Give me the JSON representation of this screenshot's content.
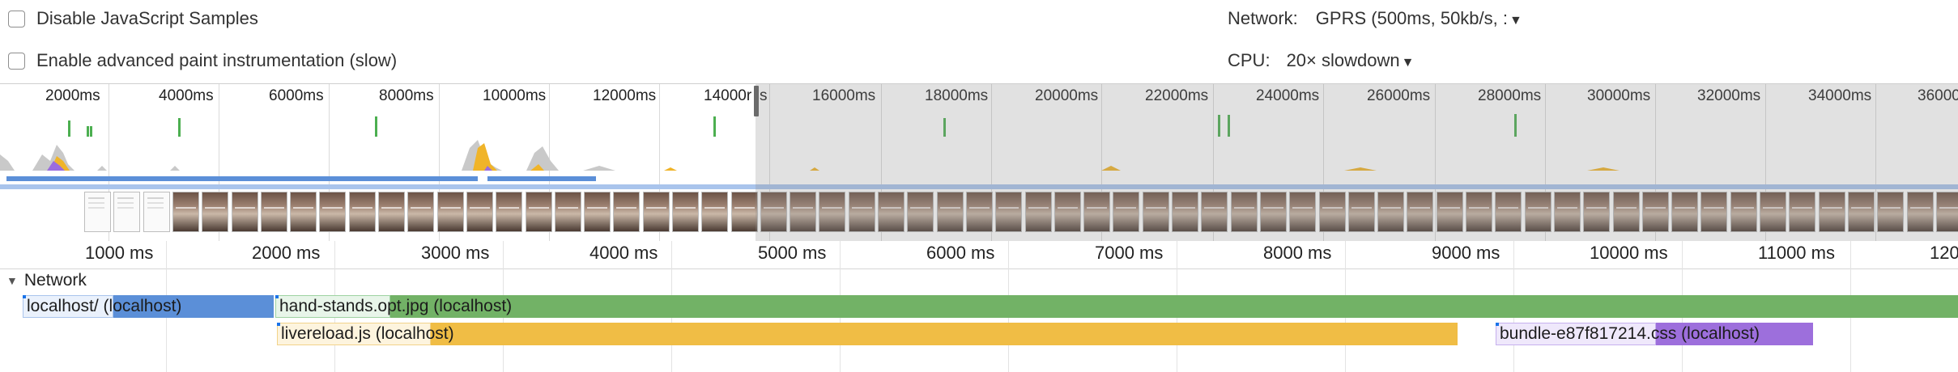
{
  "settings": {
    "disable_js_samples": {
      "label": "Disable JavaScript Samples",
      "checked": false
    },
    "advanced_paint": {
      "label": "Enable advanced paint instrumentation (slow)",
      "checked": false
    },
    "network": {
      "label": "Network:",
      "value": "GPRS (500ms, 50kb/s, :"
    },
    "cpu": {
      "label": "CPU:",
      "value": "20× slowdown"
    }
  },
  "overview": {
    "tick_labels": [
      "2000ms",
      "4000ms",
      "6000ms",
      "8000ms",
      "10000ms",
      "12000ms",
      "14000r",
      "s",
      "16000ms",
      "18000ms",
      "20000ms",
      "22000ms",
      "24000ms",
      "26000ms",
      "28000ms",
      "30000ms",
      "32000ms",
      "34000ms",
      "36000"
    ]
  },
  "ruler": {
    "labels": [
      "1000 ms",
      "2000 ms",
      "3000 ms",
      "4000 ms",
      "5000 ms",
      "6000 ms",
      "7000 ms",
      "8000 ms",
      "9000 ms",
      "10000 ms",
      "11000 ms",
      "120"
    ]
  },
  "network": {
    "section_label": "Network",
    "requests": [
      {
        "name": "localhost/ (localhost)",
        "color": "#4a90e2"
      },
      {
        "name": "hand-stands.opt.jpg (localhost)",
        "color": "#4caf50"
      },
      {
        "name": "livereload.js (localhost)",
        "color": "#f0b429"
      },
      {
        "name": "bundle-e87f817214.css (localhost)",
        "color": "#9b6dde"
      }
    ]
  },
  "colors": {
    "scripting": "#f0b429",
    "paint": "#4caf50",
    "loading": "#9b6dde",
    "network_blue": "#4a90e2"
  }
}
